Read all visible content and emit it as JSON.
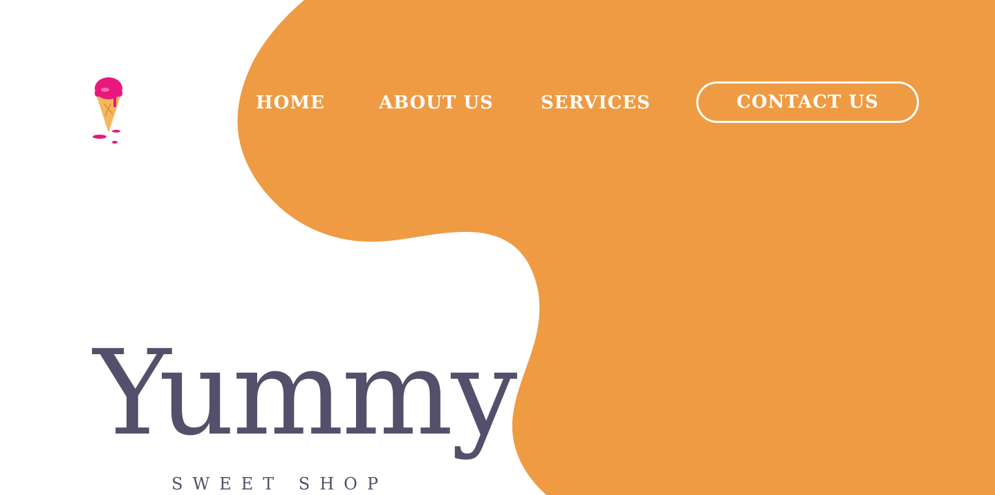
{
  "colors": {
    "accent_orange": "#ef9b43",
    "text_slate": "#52506a",
    "logo_pink": "#e8187e",
    "cone_tan": "#f7b75c",
    "white": "#ffffff"
  },
  "header": {
    "logo_icon": "ice-cream-cone-icon",
    "nav": {
      "home": "HOME",
      "about": "ABOUT US",
      "services": "SERVICES",
      "contact": "CONTACT US"
    }
  },
  "hero": {
    "title": "Yummy",
    "subtitle": "SWEET SHOP"
  }
}
